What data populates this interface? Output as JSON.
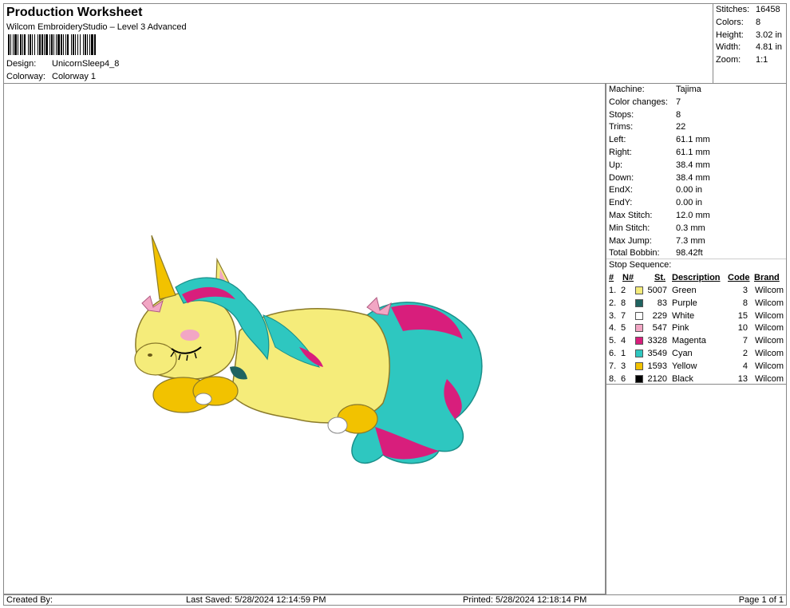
{
  "header": {
    "title": "Production Worksheet",
    "subtitle": "Wilcom EmbroideryStudio – Level 3 Advanced",
    "design_label": "Design:",
    "design_value": "UnicornSleep4_8",
    "colorway_label": "Colorway:",
    "colorway_value": "Colorway 1"
  },
  "summary": {
    "stitches_label": "Stitches:",
    "stitches_value": "16458",
    "colors_label": "Colors:",
    "colors_value": "8",
    "height_label": "Height:",
    "height_value": "3.02 in",
    "width_label": "Width:",
    "width_value": "4.81 in",
    "zoom_label": "Zoom:",
    "zoom_value": "1:1"
  },
  "specs": [
    {
      "label": "Machine:",
      "value": "Tajima"
    },
    {
      "label": "Color changes:",
      "value": "7"
    },
    {
      "label": "Stops:",
      "value": "8"
    },
    {
      "label": "Trims:",
      "value": "22"
    },
    {
      "label": "Left:",
      "value": "61.1 mm"
    },
    {
      "label": "Right:",
      "value": "61.1 mm"
    },
    {
      "label": "Up:",
      "value": "38.4 mm"
    },
    {
      "label": "Down:",
      "value": "38.4 mm"
    },
    {
      "label": "EndX:",
      "value": "0.00 in"
    },
    {
      "label": "EndY:",
      "value": "0.00 in"
    },
    {
      "label": "Max Stitch:",
      "value": "12.0 mm"
    },
    {
      "label": "Min Stitch:",
      "value": "0.3 mm"
    },
    {
      "label": "Max Jump:",
      "value": "7.3 mm"
    },
    {
      "label": "Total Bobbin:",
      "value": "98.42ft"
    }
  ],
  "stop_sequence": {
    "title": "Stop Sequence:",
    "headers": {
      "num": "#",
      "n": "N#",
      "st": "St.",
      "desc": "Description",
      "code": "Code",
      "brand": "Brand"
    },
    "rows": [
      {
        "idx": "1.",
        "n": "2",
        "st": "5007",
        "desc": "Green",
        "code": "3",
        "brand": "Wilcom",
        "color": "#f5ec7a"
      },
      {
        "idx": "2.",
        "n": "8",
        "st": "83",
        "desc": "Purple",
        "code": "8",
        "brand": "Wilcom",
        "color": "#1f6360"
      },
      {
        "idx": "3.",
        "n": "7",
        "st": "229",
        "desc": "White",
        "code": "15",
        "brand": "Wilcom",
        "color": "#ffffff"
      },
      {
        "idx": "4.",
        "n": "5",
        "st": "547",
        "desc": "Pink",
        "code": "10",
        "brand": "Wilcom",
        "color": "#f2a6c4"
      },
      {
        "idx": "5.",
        "n": "4",
        "st": "3328",
        "desc": "Magenta",
        "code": "7",
        "brand": "Wilcom",
        "color": "#d81e7c"
      },
      {
        "idx": "6.",
        "n": "1",
        "st": "3549",
        "desc": "Cyan",
        "code": "2",
        "brand": "Wilcom",
        "color": "#2ec7c0"
      },
      {
        "idx": "7.",
        "n": "3",
        "st": "1593",
        "desc": "Yellow",
        "code": "4",
        "brand": "Wilcom",
        "color": "#f2c200"
      },
      {
        "idx": "8.",
        "n": "6",
        "st": "2120",
        "desc": "Black",
        "code": "13",
        "brand": "Wilcom",
        "color": "#000000"
      }
    ]
  },
  "footer": {
    "created_by": "Created By:",
    "last_saved": "Last Saved: 5/28/2024 12:14:59 PM",
    "printed": "Printed: 5/28/2024 12:18:14 PM",
    "page": "Page 1 of 1"
  }
}
